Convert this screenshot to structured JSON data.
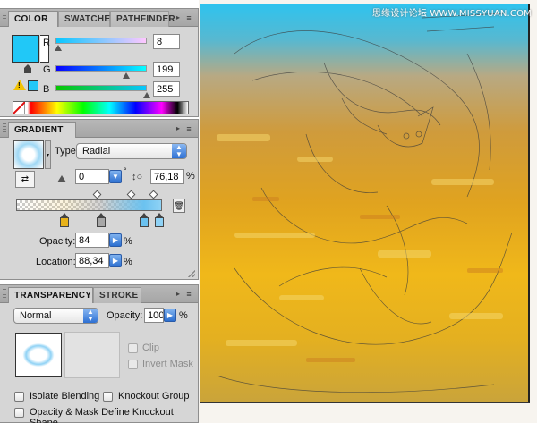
{
  "watermark": "思缘设计论坛 WWW.MISSYUAN.COM",
  "color_panel": {
    "tabs": [
      "COLOR",
      "SWATCHES",
      "PATHFINDER"
    ],
    "menu_icon": "panel-menu-icon",
    "fill_color": "#21c8f7",
    "channels": [
      {
        "label": "R",
        "value": "8",
        "fraction": 0.031
      },
      {
        "label": "G",
        "value": "199",
        "fraction": 0.78
      },
      {
        "label": "B",
        "value": "255",
        "fraction": 1.0
      }
    ],
    "warning_icon": "out-of-gamut-warning-icon"
  },
  "gradient_panel": {
    "tab": "GRADIENT",
    "type_label": "Type",
    "type_value": "Radial",
    "angle_value": "0",
    "aspect_value": "76,18",
    "percent": "%",
    "degree": "°",
    "stops": [
      {
        "color": "#e8b21a",
        "location": 0.33
      },
      {
        "color": "#a7a7a7",
        "location": 0.58
      },
      {
        "color": "#6bc2f0",
        "location": 0.88
      },
      {
        "color": "#8fd2f5",
        "location": 0.98
      }
    ],
    "opacity_label": "Opacity:",
    "opacity_value": "84",
    "location_label": "Location:",
    "location_value": "88,34"
  },
  "transparency_panel": {
    "tabs": [
      "TRANSPARENCY",
      "STROKE"
    ],
    "blend_mode": "Normal",
    "opacity_label": "Opacity:",
    "opacity_value": "100",
    "percent": "%",
    "clip_label": "Clip",
    "invert_mask_label": "Invert Mask",
    "isolate_label": "Isolate Blending",
    "knockout_label": "Knockout Group",
    "opacity_mask_label": "Opacity & Mask Define Knockout Shape"
  }
}
